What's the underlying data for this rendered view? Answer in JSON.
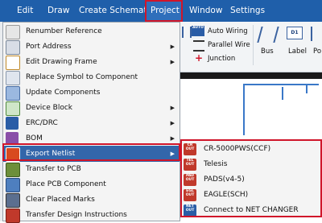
{
  "menubar": {
    "items": [
      {
        "label": "Edit"
      },
      {
        "label": "Draw"
      },
      {
        "label": "Create Schematic"
      },
      {
        "label": "Project"
      },
      {
        "label": "Window"
      },
      {
        "label": "Settings"
      }
    ]
  },
  "ribbon": {
    "auto_wiring": "Auto Wiring",
    "parallel_wire": "Parallel Wire",
    "junction": "Junction",
    "bus": "Bus",
    "label": "Label",
    "po": "Po",
    "d1_icon_text": "D1",
    "auto_icon_text": "AUTO"
  },
  "project_menu": {
    "items": [
      {
        "label": "Renumber Reference",
        "icon": "renumber-icon"
      },
      {
        "label": "Port Address",
        "icon": "port-icon"
      },
      {
        "label": "Edit Drawing Frame",
        "icon": "frame-icon"
      },
      {
        "label": "Replace Symbol to Component",
        "icon": "replace-icon"
      },
      {
        "label": "Update Components",
        "icon": "update-icon"
      },
      {
        "label": "Device Block",
        "icon": "device-block-icon"
      },
      {
        "label": "ERC/DRC",
        "icon": "erc-drc-icon"
      },
      {
        "label": "BOM",
        "icon": "bom-icon"
      },
      {
        "label": "Export Netlist",
        "icon": "netlist-out-icon"
      },
      {
        "label": "Transfer to PCB",
        "icon": "transfer-pcb-icon"
      },
      {
        "label": "Place PCB Component",
        "icon": "place-pcb-icon"
      },
      {
        "label": "Clear Placed Marks",
        "icon": "clear-marks-icon"
      },
      {
        "label": "Transfer Design Instructions",
        "icon": "transfer-design-icon"
      }
    ]
  },
  "export_submenu": {
    "items": [
      {
        "label": "CR-5000PWS(CCF)",
        "icon_text": "CR OUT"
      },
      {
        "label": "Telesis",
        "icon_text": "TEL OUT"
      },
      {
        "label": "PADS(v4-5)",
        "icon_text": "PAD OUT"
      },
      {
        "label": "EAGLE(SCH)",
        "icon_text": "EGL OUT"
      },
      {
        "label": "Connect to NET CHANGER",
        "icon_text": "NET OUT"
      }
    ]
  },
  "colors": {
    "menubar_bg": "#1f5faa",
    "highlight": "#3366aa",
    "red_frame": "#d0152a"
  }
}
